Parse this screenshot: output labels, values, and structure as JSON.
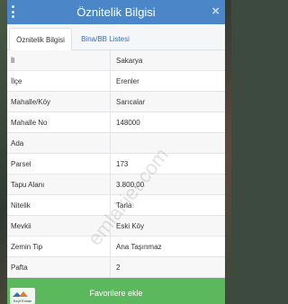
{
  "header": {
    "title": "Öznitelik Bilgisi",
    "close_label": "×"
  },
  "tabs": [
    {
      "label": "Öznitelik Bilgisi",
      "active": true
    },
    {
      "label": "Bina/BB Listesi",
      "active": false
    }
  ],
  "rows": [
    {
      "label": "İl",
      "value": "Sakarya"
    },
    {
      "label": "İlçe",
      "value": "Erenler"
    },
    {
      "label": "Mahalle/Köy",
      "value": "Sarıcalar"
    },
    {
      "label": "Mahalle No",
      "value": "148000"
    },
    {
      "label": "Ada",
      "value": ""
    },
    {
      "label": "Parsel",
      "value": "173"
    },
    {
      "label": "Tapu Alanı",
      "value": "3.800,00"
    },
    {
      "label": "Nitelik",
      "value": "Tarla"
    },
    {
      "label": "Mevkii",
      "value": "Eski Köy"
    },
    {
      "label": "Zemin Tip",
      "value": "Ana Taşınmaz"
    },
    {
      "label": "Pafta",
      "value": "2"
    }
  ],
  "watermark": "emlakjet.com",
  "favorite_button": {
    "label": "Favorilere ekle"
  },
  "logo": {
    "text": "Keyf Emlak"
  },
  "colors": {
    "header": "#4a86c8",
    "button": "#5cb85c",
    "link": "#3b6fb0"
  }
}
